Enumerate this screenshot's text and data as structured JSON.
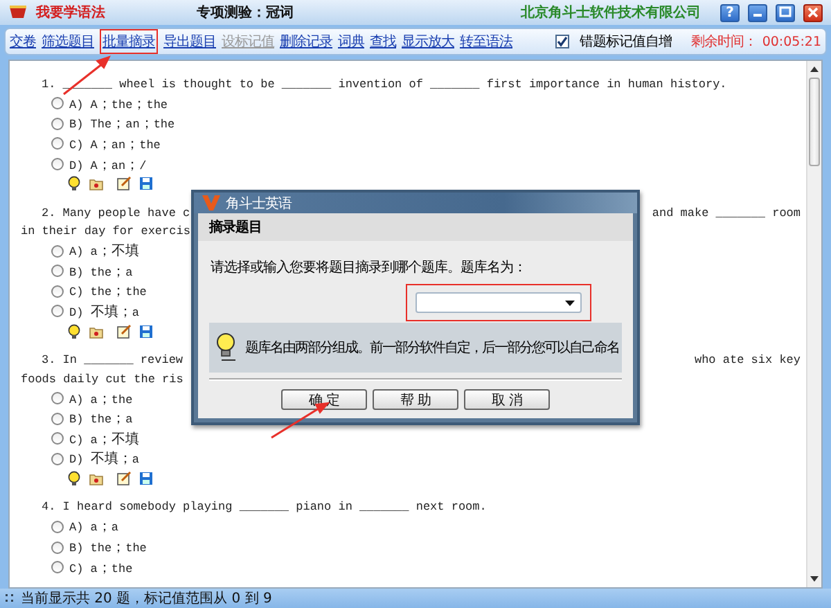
{
  "title_bar": {
    "app_name": "我要学语法",
    "test_name": "专项测验：冠词",
    "company": "北京角斗士软件技术有限公司",
    "help_button": "?"
  },
  "toolbar": {
    "items": [
      {
        "label": "交卷",
        "disabled": false,
        "highlighted": false
      },
      {
        "label": "筛选题目",
        "disabled": false,
        "highlighted": false
      },
      {
        "label": "批量摘录",
        "disabled": false,
        "highlighted": true
      },
      {
        "label": "导出题目",
        "disabled": false,
        "highlighted": false
      },
      {
        "label": "设标记值",
        "disabled": true,
        "highlighted": false
      },
      {
        "label": "删除记录",
        "disabled": false,
        "highlighted": false
      },
      {
        "label": "词典",
        "disabled": false,
        "highlighted": false
      },
      {
        "label": "查找",
        "disabled": false,
        "highlighted": false
      },
      {
        "label": "显示放大",
        "disabled": false,
        "highlighted": false
      },
      {
        "label": "转至语法",
        "disabled": false,
        "highlighted": false
      }
    ],
    "auto_increment": {
      "label": "错题标记值自增",
      "checked": true
    },
    "timer": {
      "label": "剩余时间：",
      "value": "00:05:21"
    }
  },
  "questions": [
    {
      "lines": [
        {
          "left": "1. _______ wheel is thought to be _______ invention of _______ first importance in human history."
        }
      ],
      "options": [
        {
          "label": "A) A；the；the",
          "selected": false
        },
        {
          "label": "B) The；an；the",
          "selected": false
        },
        {
          "label": "C) A；an；the",
          "selected": false
        },
        {
          "label": "D) A；an；/",
          "selected": false
        }
      ],
      "tools": true
    },
    {
      "lines": [
        {
          "left": "2. Many people have c",
          "right": "and make _______ room"
        },
        {
          "left": "in their day for exercis"
        }
      ],
      "options": [
        {
          "label": "A) a；不填",
          "selected": false
        },
        {
          "label": "B) the；a",
          "selected": false
        },
        {
          "label": "C) the；the",
          "selected": false
        },
        {
          "label": "D) 不填；a",
          "selected": false
        }
      ],
      "tools": true
    },
    {
      "lines": [
        {
          "left": "3. In _______ review",
          "right": "who ate six key"
        },
        {
          "left": "foods daily cut the ris"
        }
      ],
      "options": [
        {
          "label": "A) a；the",
          "selected": false
        },
        {
          "label": "B) the；a",
          "selected": false
        },
        {
          "label": "C) a；不填",
          "selected": false
        },
        {
          "label": "D) 不填；a",
          "selected": false
        }
      ],
      "tools": true
    },
    {
      "lines": [
        {
          "left": "4. I heard somebody playing _______ piano in _______ next room."
        }
      ],
      "options": [
        {
          "label": "A) a；a",
          "selected": false
        },
        {
          "label": "B) the；the",
          "selected": false
        },
        {
          "label": "C) a；the",
          "selected": false
        }
      ],
      "tools": false
    }
  ],
  "dialog": {
    "title": "角斗士英语",
    "heading": "摘录题目",
    "prompt": "请选择或输入您要将题目摘录到哪个题库。题库名为：",
    "library_field": {
      "highlighted": true
    },
    "note": "题库名由两部分组成。前一部分软件自定，后一部分您可以自己命名",
    "buttons": [
      "确 定",
      "帮 助",
      "取 消"
    ]
  },
  "status_bar": "当前显示共 20 题，标记值范围从 0 到 9"
}
